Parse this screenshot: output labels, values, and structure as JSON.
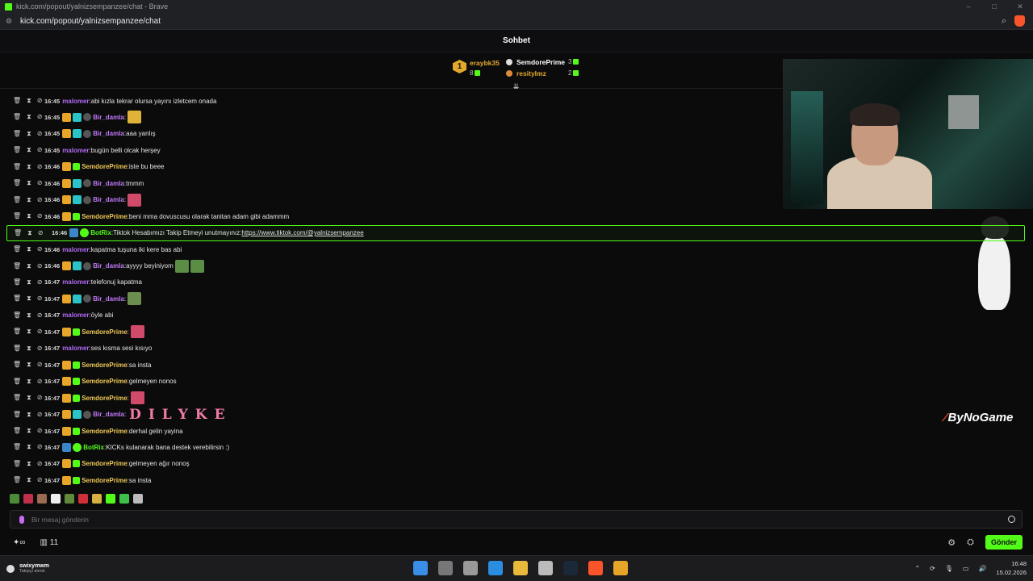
{
  "browser": {
    "title": "kick.com/popout/yalnizsempanzee/chat - Brave",
    "url": "kick.com/popout/yalnizsempanzee/chat",
    "minimize": "–",
    "maximize": "□",
    "close": "✕"
  },
  "header": {
    "title": "Sohbet"
  },
  "leaderboard": {
    "rank_badge": "1",
    "entries": [
      {
        "name": "eraybk35",
        "count": "8"
      },
      {
        "name": "SemdorePrime",
        "count": "3"
      },
      {
        "name": "resitylmz",
        "count": "2"
      }
    ]
  },
  "messages": [
    {
      "time": "16:45",
      "user": "malomer",
      "text": "abi kızla tekrar olursa yayını izletcem onada"
    },
    {
      "time": "16:45",
      "user": "Bir_damla",
      "text": ""
    },
    {
      "time": "16:45",
      "user": "Bir_damla",
      "text": "aaa yanlış"
    },
    {
      "time": "16:45",
      "user": "malomer",
      "text": "bugün belli olcak herşey"
    },
    {
      "time": "16:46",
      "user": "SemdorePrime",
      "text": "iste bu beee"
    },
    {
      "time": "16:46",
      "user": "Bir_damla",
      "text": "tmmm"
    },
    {
      "time": "16:46",
      "user": "Bir_damla",
      "text": ""
    },
    {
      "time": "16:46",
      "user": "SemdorePrime",
      "text": "beni mma dovuscusu olarak tanitan adam gibi adammm"
    },
    {
      "time": "16:46",
      "user": "BotRix",
      "text": "Tiktok Hesabımızı Takip Etmeyi unutmayınız: ",
      "link": "https://www.tiktok.com/@yalnizsempanzee"
    },
    {
      "time": "16:46",
      "user": "malomer",
      "text": "kapatma tuşuna iki kere bas abi"
    },
    {
      "time": "16:46",
      "user": "Bir_damla",
      "text": "ayyyy beyiniyom"
    },
    {
      "time": "16:47",
      "user": "malomer",
      "text": "telefonuj kapatma"
    },
    {
      "time": "16:47",
      "user": "Bir_damla",
      "text": ""
    },
    {
      "time": "16:47",
      "user": "malomer",
      "text": "öyle abi"
    },
    {
      "time": "16:47",
      "user": "SemdorePrime",
      "text": ""
    },
    {
      "time": "16:47",
      "user": "malomer",
      "text": "ses kısma sesi kısıyo"
    },
    {
      "time": "16:47",
      "user": "SemdorePrime",
      "text": "sa insta"
    },
    {
      "time": "16:47",
      "user": "SemdorePrime",
      "text": "gelmeyen nonos"
    },
    {
      "time": "16:47",
      "user": "SemdorePrime",
      "text": ""
    },
    {
      "time": "16:47",
      "user": "Bir_damla",
      "text": "DILYKE"
    },
    {
      "time": "16:47",
      "user": "SemdorePrime",
      "text": "derhal gelin yayina"
    },
    {
      "time": "16:47",
      "user": "BotRix",
      "text": "KICKs kulanarak bana destek verebilirsin :)"
    },
    {
      "time": "16:47",
      "user": "SemdorePrime",
      "text": "gelmeyen ağır nonoş"
    },
    {
      "time": "16:47",
      "user": "SemdorePrime",
      "text": "sa insta"
    }
  ],
  "colors": {
    "malomer": "#b36bf6",
    "Bir_damla": "#c07af5",
    "SemdorePrime": "#f0c955",
    "BotRix": "#53fc18",
    "accent": "#53fc18"
  },
  "watermark": {
    "text": "ByNoGame"
  },
  "composer": {
    "placeholder": "Bir mesaj gönderin",
    "send_label": "Gönder",
    "count": "11",
    "infinity": "∞"
  },
  "taskbar": {
    "user_name": "swixymwm",
    "user_status": "Takipçi alındı",
    "time": "16:48",
    "date": "15.02.2026"
  }
}
